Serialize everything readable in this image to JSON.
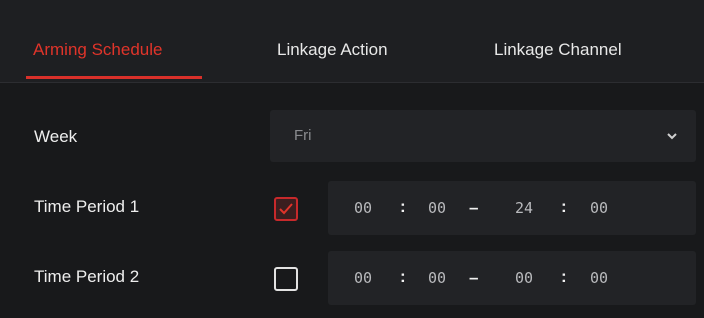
{
  "tabs": [
    {
      "label": "Arming Schedule",
      "active": true
    },
    {
      "label": "Linkage Action",
      "active": false
    },
    {
      "label": "Linkage Channel",
      "active": false
    }
  ],
  "week": {
    "label": "Week",
    "value": "Fri"
  },
  "time_periods": [
    {
      "label": "Time Period 1",
      "checked": true,
      "start_hour": "00",
      "start_min": "00",
      "end_hour": "24",
      "end_min": "00"
    },
    {
      "label": "Time Period 2",
      "checked": false,
      "start_hour": "00",
      "start_min": "00",
      "end_hour": "00",
      "end_min": "00"
    }
  ],
  "symbols": {
    "colon": ":",
    "dash": "–"
  },
  "colors": {
    "accent": "#e0342a",
    "background": "#18191b",
    "panel": "#222326"
  },
  "icons": {
    "dropdown": "chevron-down-icon",
    "check": "checkmark-icon"
  }
}
